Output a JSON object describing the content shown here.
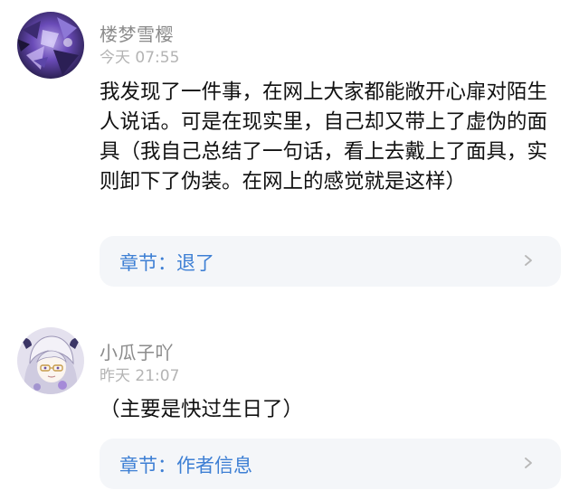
{
  "comments": [
    {
      "username": "楼梦雪樱",
      "time": "今天 07:55",
      "text": "我发现了一件事，在网上大家都能敞开心扉对陌生人说话。可是在现实里，自己却又带上了虚伪的面具（我自己总结了一句话，看上去戴上了面具，实则卸下了伪装。在网上的感觉就是这样）",
      "chapter": "章节：退了"
    },
    {
      "username": "小瓜子吖",
      "time": "昨天 21:07",
      "text": "（主要是快过生日了）",
      "chapter": "章节：作者信息"
    }
  ],
  "colors": {
    "username": "#8b8b8b",
    "timestamp": "#b4b4b4",
    "content": "#111111",
    "chapter_link": "#3d7fd4",
    "chapter_card_bg": "#f4f6f9"
  },
  "icons": {
    "chapter_arrow": "chevron-right-icon",
    "avatar_1": "user-avatar",
    "avatar_2": "user-avatar"
  }
}
